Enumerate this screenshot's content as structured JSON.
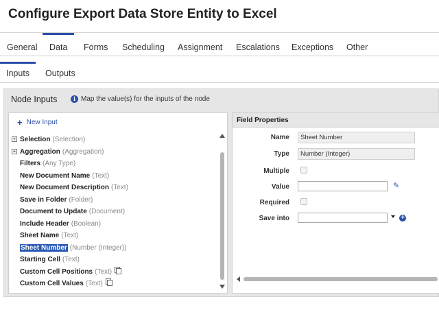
{
  "page": {
    "title": "Configure Export Data Store Entity to Excel"
  },
  "tabs": [
    {
      "label": "General"
    },
    {
      "label": "Data"
    },
    {
      "label": "Forms"
    },
    {
      "label": "Scheduling"
    },
    {
      "label": "Assignment"
    },
    {
      "label": "Escalations"
    },
    {
      "label": "Exceptions"
    },
    {
      "label": "Other"
    }
  ],
  "active_tab": "Data",
  "subtabs": [
    {
      "label": "Inputs"
    },
    {
      "label": "Outputs"
    }
  ],
  "active_subtab": "Inputs",
  "node_inputs": {
    "title": "Node Inputs",
    "hint": "Map the value(s) for the inputs of the node",
    "new_input_label": "New Input",
    "items": [
      {
        "name": "Selection",
        "type": "(Selection)",
        "expandable": true
      },
      {
        "name": "Aggregation",
        "type": "(Aggregation)",
        "expandable": true
      },
      {
        "name": "Filters",
        "type": "(Any Type)"
      },
      {
        "name": "New Document Name",
        "type": "(Text)"
      },
      {
        "name": "New Document Description",
        "type": "(Text)"
      },
      {
        "name": "Save in Folder",
        "type": "(Folder)"
      },
      {
        "name": "Document to Update",
        "type": "(Document)"
      },
      {
        "name": "Include Header",
        "type": "(Boolean)"
      },
      {
        "name": "Sheet Name",
        "type": "(Text)"
      },
      {
        "name": "Sheet Number",
        "type": "(Number (Integer))",
        "selected": true
      },
      {
        "name": "Starting Cell",
        "type": "(Text)"
      },
      {
        "name": "Custom Cell Positions",
        "type": "(Text)",
        "copy_icon": true
      },
      {
        "name": "Custom Cell Values",
        "type": "(Text)",
        "copy_icon": true
      }
    ]
  },
  "field_properties": {
    "title": "Field Properties",
    "name_label": "Name",
    "name_value": "Sheet Number",
    "type_label": "Type",
    "type_value": "Number (Integer)",
    "multiple_label": "Multiple",
    "value_label": "Value",
    "value_value": "",
    "required_label": "Required",
    "save_into_label": "Save into",
    "save_into_value": ""
  },
  "colors": {
    "accent": "#2b4ea8",
    "selection": "#2b59b5",
    "panel_bg": "#e6e6e6"
  }
}
